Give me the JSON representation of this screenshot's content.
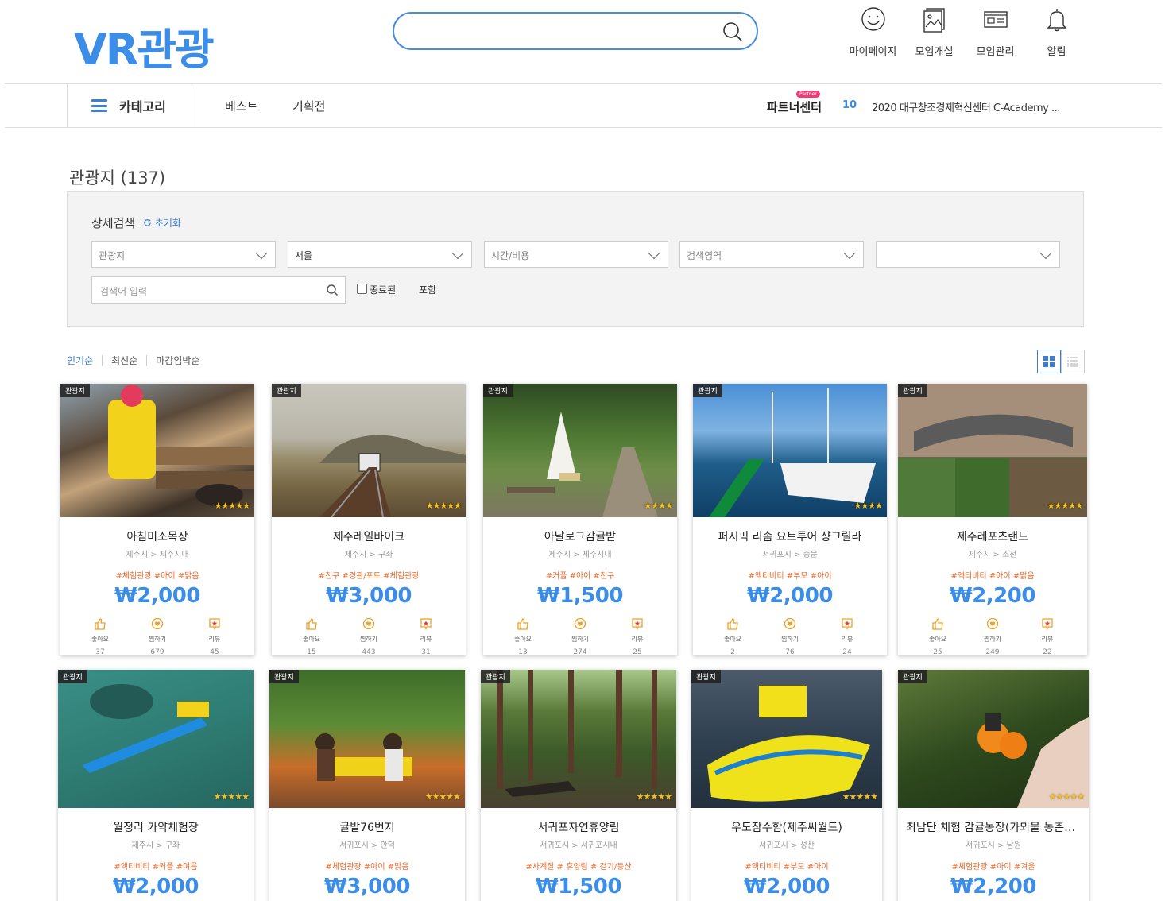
{
  "header": {
    "logo": "VR관광",
    "search_placeholder": "",
    "nav": [
      {
        "label": "마이페이지",
        "icon": "smiley-icon"
      },
      {
        "label": "모임개설",
        "icon": "image-board-icon"
      },
      {
        "label": "모임관리",
        "icon": "id-card-icon"
      },
      {
        "label": "알림",
        "icon": "bell-icon"
      }
    ]
  },
  "navbar": {
    "category": "카테고리",
    "links": [
      "베스트",
      "기획전"
    ],
    "partner": "파트너센터",
    "partner_badge": "Partner",
    "notice_num": "10",
    "notice_text": "2020 대구창조경제혁신센터 C-Academy ..."
  },
  "section": {
    "title": "관광지 (137)"
  },
  "filter": {
    "title": "상세검색",
    "reset": "초기화",
    "selects": [
      "관광지",
      "서울",
      "시간/비용",
      "검색영역",
      ""
    ],
    "keyword_placeholder": "검색어 입력",
    "ended_label": "종료된",
    "include_label": "포함"
  },
  "sort": [
    "인기순",
    "최신순",
    "마감임박순"
  ],
  "stat_labels": {
    "like": "좋아요",
    "pick": "찜하기",
    "review": "리뷰"
  },
  "cards": [
    {
      "tag": "관광지",
      "name": "아침미소목장",
      "loc": "제주시 > 제주시내",
      "tags": "#체험관광 #아이 #맑음",
      "price": "₩2,000",
      "stars": "★★★★★",
      "likes": "37",
      "picks": "679",
      "reviews": "45"
    },
    {
      "tag": "관광지",
      "name": "제주레일바이크",
      "loc": "제주시 > 구좌",
      "tags": "#친구 #경관/포토 #체험관광",
      "price": "₩3,000",
      "stars": "★★★★★",
      "likes": "15",
      "picks": "443",
      "reviews": "31"
    },
    {
      "tag": "관광지",
      "name": "아날로그감귤밭",
      "loc": "제주시 > 제주시내",
      "tags": "#커플 #아이 #친구",
      "price": "₩1,500",
      "stars": "★★★★",
      "likes": "13",
      "picks": "274",
      "reviews": "25"
    },
    {
      "tag": "관광지",
      "name": "퍼시픽 리솜 요트투어 샹그릴라",
      "loc": "서귀포시 > 중문",
      "tags": "#액티비티 #부모 #아이",
      "price": "₩2,000",
      "stars": "★★★★",
      "likes": "2",
      "picks": "76",
      "reviews": "24"
    },
    {
      "tag": "관광지",
      "name": "제주레포츠랜드",
      "loc": "제주시 > 조천",
      "tags": "#액티비티 #아이 #맑음",
      "price": "₩2,200",
      "stars": "★★★★★",
      "likes": "25",
      "picks": "249",
      "reviews": "22"
    },
    {
      "tag": "관광지",
      "name": "월정리 카약체험장",
      "loc": "제주시 > 구좌",
      "tags": "#액티비티 #커플 #여름",
      "price": "₩2,000",
      "stars": "★★★★★"
    },
    {
      "tag": "관광지",
      "name": "귤밭76번지",
      "loc": "서귀포시 > 안덕",
      "tags": "#체험관광 #아이 #맑음",
      "price": "₩3,000",
      "stars": "★★★★★"
    },
    {
      "tag": "관광지",
      "name": "서귀포자연휴양림",
      "loc": "서귀포시 > 서귀포시내",
      "tags": "#사계절 # 휴양림 # 걷기/등산",
      "price": "₩1,500",
      "stars": "★★★★★"
    },
    {
      "tag": "관광지",
      "name": "우도잠수함(제주씨월드)",
      "loc": "서귀포시 > 성산",
      "tags": "#액티비티 #부모 #아이",
      "price": "₩2,000",
      "stars": "★★★★★"
    },
    {
      "tag": "관광지",
      "name": "최남단 체험 감귤농장(가뫼물 농촌생...",
      "loc": "서귀포시 > 남원",
      "tags": "#체험관광 #아이 #겨울",
      "price": "₩2,200",
      "stars": "★★★★★"
    }
  ],
  "colors": {
    "brand": "#3b8de8",
    "tag_text": "#f06a2a",
    "badge": "#ef3e77"
  }
}
